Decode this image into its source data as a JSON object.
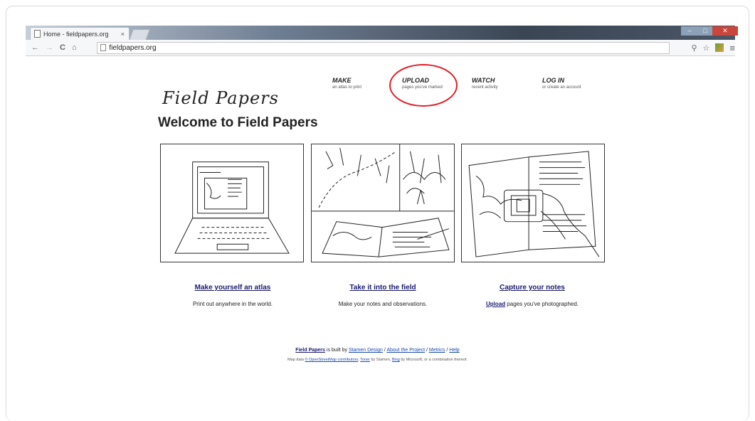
{
  "browser": {
    "tab_title": "Home - fieldpapers.org",
    "tab_close": "×",
    "url": "fieldpapers.org",
    "back": "←",
    "forward": "→",
    "reload": "C",
    "home": "⌂",
    "zoom_icon": "⚲",
    "star_icon": "☆",
    "menu_icon": "≡",
    "min": "–",
    "max": "□",
    "close": "✕"
  },
  "site": {
    "logo": "Field Papers",
    "nav": [
      {
        "title": "MAKE",
        "sub": "an atlas to print"
      },
      {
        "title": "UPLOAD",
        "sub": "pages you've marked"
      },
      {
        "title": "WATCH",
        "sub": "recent activity"
      },
      {
        "title": "LOG IN",
        "sub": "or create an account"
      }
    ],
    "heading": "Welcome to Field Papers",
    "columns": [
      {
        "link": "Make yourself an atlas",
        "desc": "Print out anywhere in the world."
      },
      {
        "link": "Take it into the field",
        "desc": "Make your notes and observations."
      },
      {
        "link": "Capture your notes",
        "desc_link": "Upload",
        "desc": " pages you've photographed."
      }
    ],
    "footer": {
      "brand": "Field Papers",
      "built_by": " is built by ",
      "stamen": "Stamen Design",
      "sep": " / ",
      "about": "About the Project",
      "metrics": "Metrics",
      "help": "Help",
      "map_data": "Map data ",
      "osm": "© OpenStreetMap contributors",
      "comma": ", ",
      "toner": "Toner",
      "by_stamen": " by Stamen, ",
      "bing": "Bing",
      "rest": " by Microsoft, or a combination thereof."
    }
  },
  "colors": {
    "highlight_circle": "#e0202a",
    "link": "#1a1a6e"
  }
}
